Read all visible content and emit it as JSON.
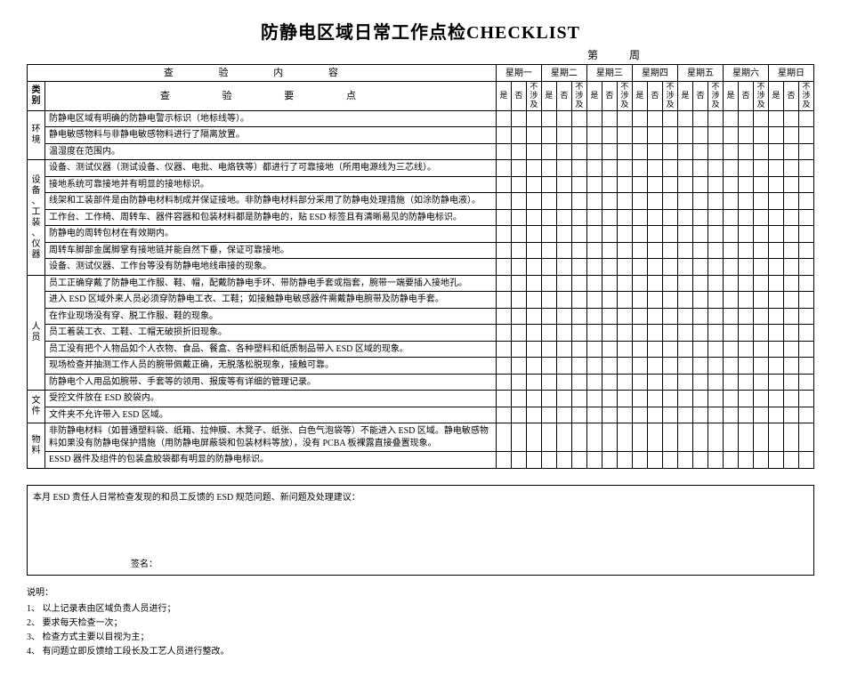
{
  "title": "防静电区域日常工作点检CHECKLIST",
  "period_label": "第  周",
  "header": {
    "content_label": "查 验 内 容",
    "category_label": "类别",
    "points_label": "查 验 要 点",
    "days": [
      "星期一",
      "星期二",
      "星期三",
      "星期四",
      "星期五",
      "星期六",
      "星期日"
    ],
    "col_yes": "是",
    "col_no": "否",
    "col_na": "不涉及"
  },
  "categories": [
    {
      "name": "环境",
      "items": [
        "防静电区域有明确的防静电警示标识（地标线等）。",
        "静电敏感物料与非静电敏感物料进行了隔离放置。",
        "温湿度在范围内。"
      ]
    },
    {
      "name": "设备、工装、仪器",
      "items": [
        "设备、测试仪器（测试设备、仪器、电批、电烙铁等）都进行了可靠接地（所用电源线为三芯线）。",
        "接地系统可靠接地并有明显的接地标识。",
        "线架和工装部件是由防静电材料制成并保证接地。非防静电材料部分采用了防静电处理措施（如涂防静电液）。",
        "工作台、工作椅、周转车、器件容器和包装材料都是防静电的，贴 ESD 标签且有清晰易见的防静电标识。",
        "防静电的周转包材在有效期内。",
        "周转车脚部金属脚掌有接地链并能自然下垂，保证可靠接地。",
        "设备、测试仪器、工作台等没有防静电地线串接的现象。"
      ]
    },
    {
      "name": "人员",
      "items": [
        "员工正确穿戴了防静电工作服、鞋、帽，配戴防静电手环、带防静电手套或指套，腕带一端要插入接地孔。",
        "进入 ESD 区域外来人员必须穿防静电工衣、工鞋；如接触静电敏感器件需戴静电腕带及防静电手套。",
        "在作业现场没有穿、脱工作服、鞋的现象。",
        "员工着装工衣、工鞋、工帽无破损折旧现象。",
        "员工没有把个人物品如个人衣物、食品、餐盒、各种塑料和纸质制品带入 ESD 区域的现象。",
        "现场检查并抽测工作人员的腕带佩戴正确，无脱落松脱现象，接触可靠。",
        "防静电个人用品如腕带、手套等的领用、报废等有详细的管理记录。"
      ]
    },
    {
      "name": "文件",
      "items": [
        "受控文件放在 ESD 胶袋内。",
        "文件夹不允许带入 ESD 区域。"
      ]
    },
    {
      "name": "物料",
      "items": [
        "非防静电材料（如普通塑料袋、纸箱、拉伸膜、木凳子、纸张、白色气泡袋等）不能进入 ESD 区域。静电敏感物料如果没有防静电保护措施（用防静电屏蔽袋和包装材料等放），没有 PCBA 板裸露直接叠置现象。",
        "ESSD 器件及组件的包装盒胶袋都有明显的防静电标识。"
      ]
    }
  ],
  "notes": {
    "heading": "本月 ESD 责任人日常检查发现的和员工反馈的 ESD 规范问题、新问题及处理建议：",
    "sign": "签名："
  },
  "explain": {
    "label": "说明：",
    "lines": [
      "1、 以上记录表由区域负责人员进行；",
      "2、 要求每天检查一次；",
      "3、 检查方式主要以目视为主；",
      "4、 有问题立即反馈给工段长及工艺人员进行整改。"
    ]
  }
}
